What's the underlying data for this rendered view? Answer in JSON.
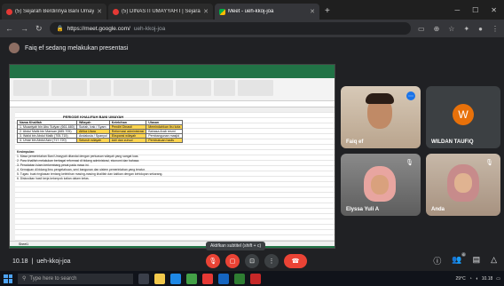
{
  "browser": {
    "tabs": [
      {
        "label": "(5) Sejarah Berdirinya Bani Umay",
        "active": false
      },
      {
        "label": "(5) DINASTI UMAYYAH I | Sejara",
        "active": false
      },
      {
        "label": "Meet - ueh-kkoj-joa",
        "active": true
      }
    ],
    "url_host": "https://meet.google.com/",
    "url_path": "ueh-kkoj-joa"
  },
  "presentation_notice": "Faiq ef sedang melakukan presentasi",
  "sheet": {
    "table_title": "PERIODE KHALIFAH BANI UMAYAH",
    "headers": [
      "Nama Khalifah",
      "Wilayah",
      "Kelebihan",
      "Ulasan"
    ],
    "rows": [
      [
        "1. Muawiyah bin Abu Sufyan (661-680)",
        "Suriah, Irak / Syam",
        "Pendiri Dinasti",
        "Memindahkan ibu kota"
      ],
      [
        "2. Abdul Malik bin Marwan (685-705)",
        "Afrika Utara",
        "Reformasi administrasi",
        "Bahasa Arab resmi"
      ],
      [
        "3. Walid bin Abdul Malik (705-715)",
        "Andalusia / Spanyol",
        "Ekspansi wilayah",
        "Pembangunan masjid"
      ],
      [
        "4. Umar bin Abdul Aziz (717-720)",
        "Seluruh wilayah",
        "Adil dan zuhud",
        "Pembukuan hadis"
      ]
    ],
    "notes_title": "Kesimpulan:",
    "notes": [
      "1. Masa pemerintahan Bani Umayyah ditandai dengan perluasan wilayah yang sangat luas.",
      "2. Para khalifah melakukan berbagai reformasi di bidang administrasi, ekonomi dan bahasa.",
      "3. Peradaban Islam berkembang pesat pada masa ini.",
      "4. Kemajuan di bidang ilmu pengetahuan, seni bangunan dan sistem pemerintahan yang teratur.",
      "5. Tugas: buat ringkasan tentang kelebihan masing-masing khalifah dan kaitkan dengan kehidupan sekarang.",
      "6. Diskusikan hasil kerja kelompok kalian dalam kelas."
    ],
    "sheet_tab": "Sheet1"
  },
  "participants": [
    {
      "name": "Faiq ef"
    },
    {
      "name": "WILDAN TAUFIQ",
      "initial": "W"
    },
    {
      "name": "Elyssa Yuli A"
    },
    {
      "name": "Anda"
    }
  ],
  "toast": "Aktifkan subtitel (shift + c)",
  "meeting": {
    "time": "10.18",
    "separator": "|",
    "code": "ueh-kkoj-joa",
    "participant_count": "6"
  },
  "taskbar": {
    "search_placeholder": "Type here to search",
    "tray_temp": "29°C",
    "tray_time": "10.18"
  }
}
